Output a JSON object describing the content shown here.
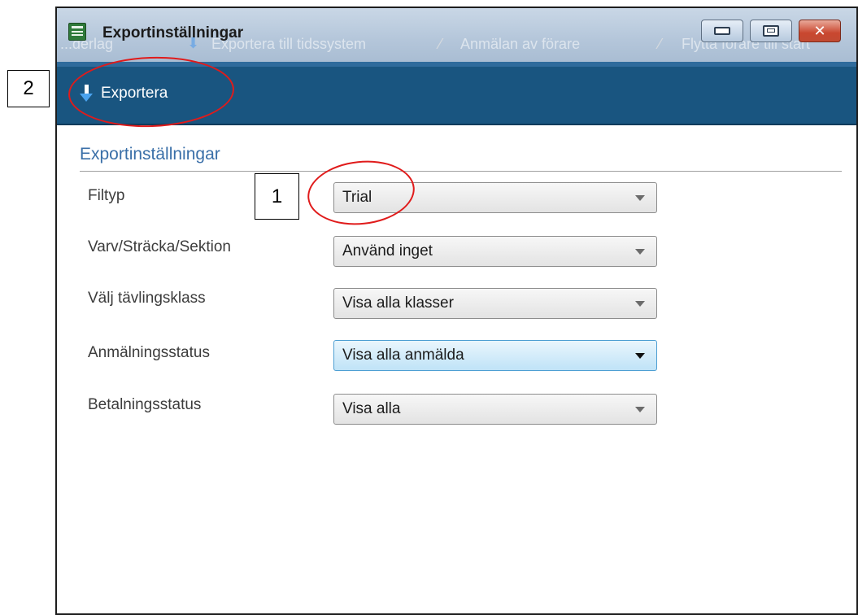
{
  "window": {
    "title": "Exportinställningar",
    "background_toolbar": [
      "...derlag",
      "Exportera till tidssystem",
      "Anmälan av förare",
      "Flytta förare till start"
    ]
  },
  "toolbar": {
    "export_label": "Exportera",
    "export_icon": "down-arrow-icon"
  },
  "section": {
    "title": "Exportinställningar"
  },
  "fields": [
    {
      "label": "Filtyp",
      "value": "Trial"
    },
    {
      "label": "Varv/Sträcka/Sektion",
      "value": "Använd inget"
    },
    {
      "label": "Välj tävlingsklass",
      "value": "Visa alla klasser"
    },
    {
      "label": "Anmälningsstatus",
      "value": "Visa alla anmälda"
    },
    {
      "label": "Betalningsstatus",
      "value": "Visa alla"
    }
  ],
  "annotations": {
    "marker_1": "1",
    "marker_2": "2",
    "ring_color": "#e01b1b"
  },
  "colors": {
    "toolbar": "#195580",
    "section_title": "#3a6fa8",
    "hover_combo": "#bfe3f7"
  }
}
